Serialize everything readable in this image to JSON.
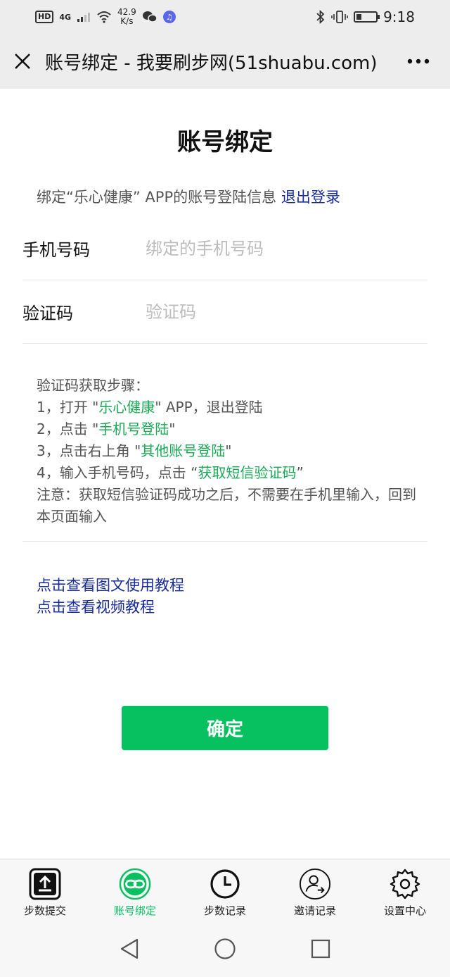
{
  "status": {
    "hd": "HD",
    "net": "4G",
    "speed_value": "42.9",
    "speed_unit": "K/s",
    "time": "9:18"
  },
  "titlebar": {
    "title": "账号绑定 - 我要刷步网(51shuabu.com)"
  },
  "page": {
    "heading": "账号绑定",
    "bind_info": "绑定“乐心健康” APP的账号登陆信息",
    "logout_link": "退出登录"
  },
  "form": {
    "phone_label": "手机号码",
    "phone_placeholder": "绑定的手机号码",
    "code_label": "验证码",
    "code_placeholder": "验证码"
  },
  "steps": {
    "title": "验证码获取步骤：",
    "s1_pre": "1，打开 \"",
    "s1_hl": "乐心健康",
    "s1_post": "\" APP，退出登陆",
    "s2_pre": "2，点击 \"",
    "s2_hl": "手机号登陆",
    "s2_post": "\"",
    "s3_pre": "3，点击右上角 \"",
    "s3_hl": "其他账号登陆",
    "s3_post": "\"",
    "s4_pre": "4，输入手机号码，点击 “",
    "s4_hl": "获取短信验证码",
    "s4_post": "”",
    "note": "注意：获取短信验证码成功之后，不需要在手机里输入，回到本页面输入"
  },
  "links": {
    "image_tutorial": "点击查看图文使用教程",
    "video_tutorial": "点击查看视频教程"
  },
  "actions": {
    "confirm": "确定"
  },
  "tabs": [
    {
      "label": "步数提交",
      "icon": "upload-icon"
    },
    {
      "label": "账号绑定",
      "icon": "link-icon"
    },
    {
      "label": "步数记录",
      "icon": "clock-icon"
    },
    {
      "label": "邀请记录",
      "icon": "user-invite-icon"
    },
    {
      "label": "设置中心",
      "icon": "gear-icon"
    }
  ],
  "colors": {
    "accent": "#07c160",
    "link": "#1a2d9e",
    "highlight": "#1aaa55"
  }
}
